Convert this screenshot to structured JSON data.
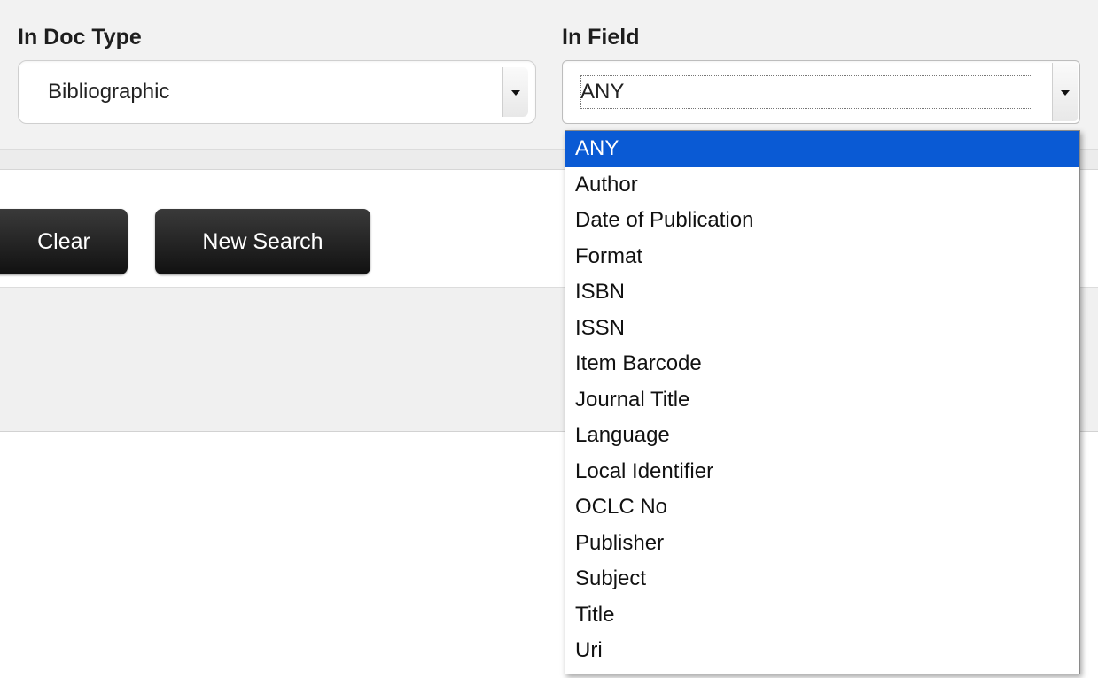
{
  "doc_type": {
    "label": "In Doc Type",
    "value": "Bibliographic"
  },
  "field": {
    "label": "In Field",
    "value": "ANY",
    "options": [
      "ANY",
      "Author",
      "Date of Publication",
      "Format",
      "ISBN",
      "ISSN",
      "Item Barcode",
      "Journal Title",
      "Language",
      "Local Identifier",
      "OCLC No",
      "Publisher",
      "Subject",
      "Title",
      "Uri"
    ],
    "selected_index": 0
  },
  "buttons": {
    "clear": "Clear",
    "new_search": "New Search"
  },
  "colors": {
    "accent_selection": "#0a5ad4",
    "button_dark": "#111111"
  }
}
